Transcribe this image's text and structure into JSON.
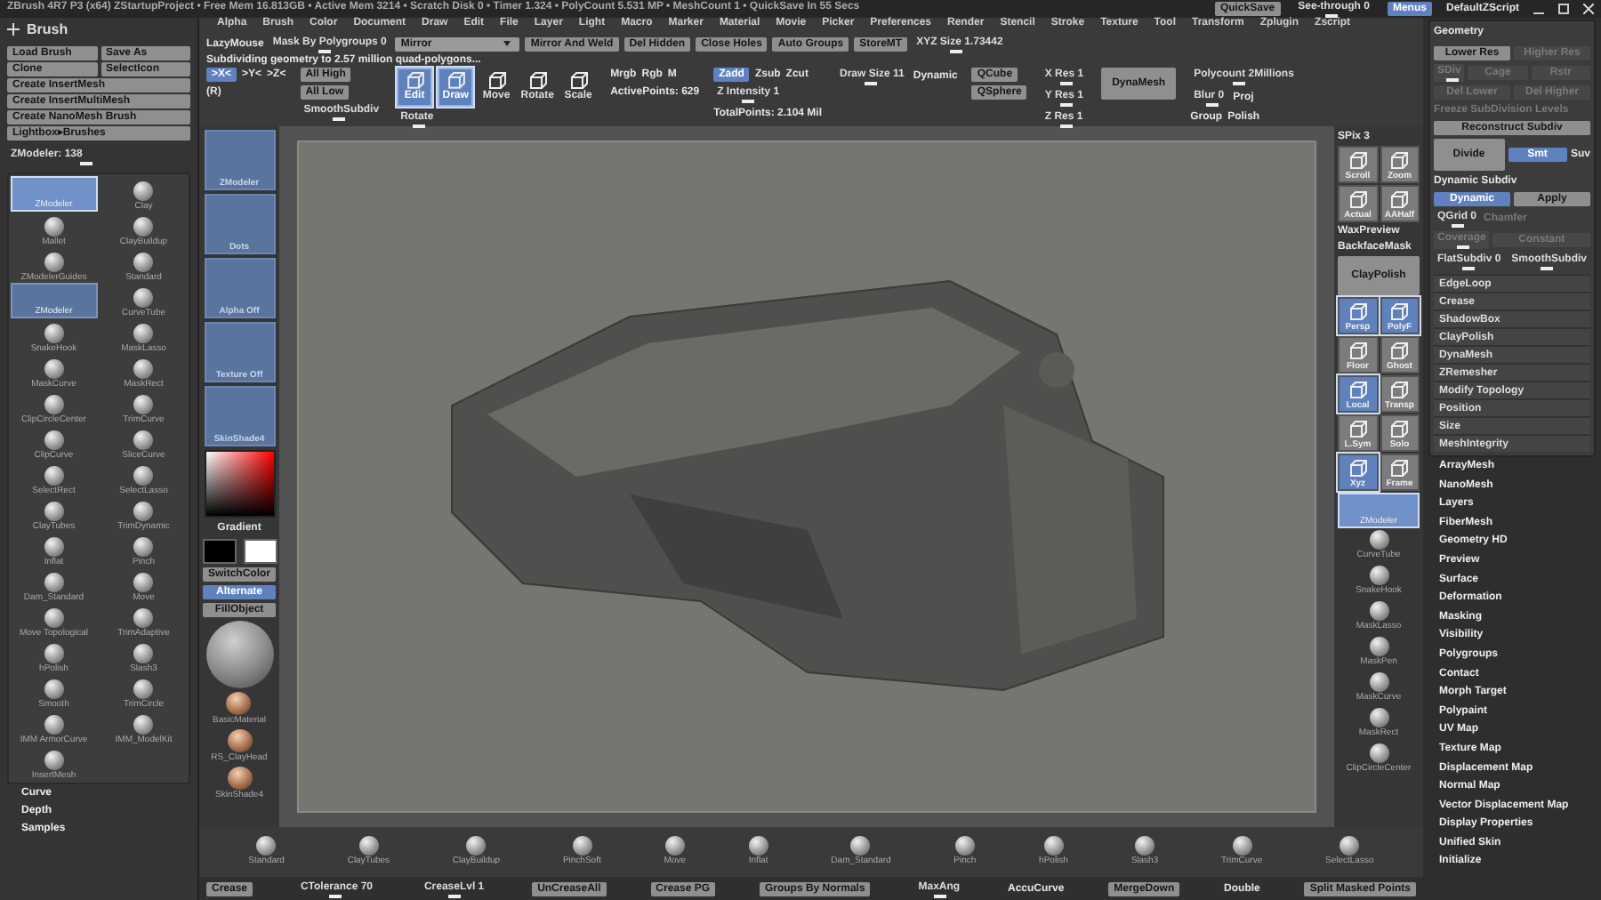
{
  "title_bar": {
    "text": "ZBrush 4R7 P3 (x64)   ZStartupProject   • Free Mem 16.813GB • Active Mem 3214 • Scratch Disk 0 • Timer 1.324 • PolyCount 5.531 MP • MeshCount 1 • QuickSave In 55 Secs",
    "controls": [
      {
        "kind": "btn",
        "label": "QuickSave",
        "selected": false
      },
      {
        "kind": "slider",
        "label": "See-through 0",
        "selected": false
      },
      {
        "kind": "btn",
        "label": "Menus",
        "selected": true
      },
      {
        "kind": "text",
        "label": "DefaultZScript",
        "selected": false
      }
    ]
  },
  "menu_bar": [
    "Alpha",
    "Brush",
    "Color",
    "Document",
    "Draw",
    "Edit",
    "File",
    "Layer",
    "Light",
    "Macro",
    "Marker",
    "Material",
    "Movie",
    "Picker",
    "Preferences",
    "Render",
    "Stencil",
    "Stroke",
    "Texture",
    "Tool",
    "Transform",
    "Zplugin",
    "Zscript"
  ],
  "brush_tray": {
    "title": "Brush",
    "buttons": [
      {
        "kind": "half",
        "label": "Load Brush"
      },
      {
        "kind": "half",
        "label": "Save As"
      },
      {
        "kind": "half",
        "label": "Clone"
      },
      {
        "kind": "half",
        "label": "SelectIcon"
      },
      {
        "kind": "full",
        "label": "Create InsertMesh"
      },
      {
        "kind": "full",
        "label": "Create InsertMultiMesh"
      },
      {
        "kind": "full",
        "label": "Create NanoMesh Brush"
      },
      {
        "kind": "full",
        "label": "Lightbox▸Brushes"
      }
    ],
    "current": "ZModeler: 138",
    "brushes": [
      {
        "kind": "tile",
        "label": "ZModeler",
        "selected": true
      },
      {
        "kind": "icon",
        "label": "Clay",
        "selected": false
      },
      {
        "kind": "icon",
        "label": "Mallet",
        "selected": false
      },
      {
        "kind": "icon",
        "label": "ClayBuildup",
        "selected": false
      },
      {
        "kind": "icon",
        "label": "ZModelerGuides",
        "selected": false
      },
      {
        "kind": "icon",
        "label": "Standard",
        "selected": false
      },
      {
        "kind": "tile",
        "label": "ZModeler",
        "selected": false
      },
      {
        "kind": "icon",
        "label": "CurveTube",
        "selected": false
      },
      {
        "kind": "icon",
        "label": "SnakeHook",
        "selected": false
      },
      {
        "kind": "icon",
        "label": "MaskLasso",
        "selected": false
      },
      {
        "kind": "icon",
        "label": "MaskCurve",
        "selected": false
      },
      {
        "kind": "icon",
        "label": "MaskRect",
        "selected": false
      },
      {
        "kind": "icon",
        "label": "ClipCircleCenter",
        "selected": false
      },
      {
        "kind": "icon",
        "label": "TrimCurve",
        "selected": false
      },
      {
        "kind": "icon",
        "label": "ClipCurve",
        "selected": false
      },
      {
        "kind": "icon",
        "label": "SliceCurve",
        "selected": false
      },
      {
        "kind": "icon",
        "label": "SelectRect",
        "selected": false
      },
      {
        "kind": "icon",
        "label": "SelectLasso",
        "selected": false
      },
      {
        "kind": "icon",
        "label": "ClayTubes",
        "selected": false
      },
      {
        "kind": "icon",
        "label": "TrimDynamic",
        "selected": false
      },
      {
        "kind": "icon",
        "label": "Inflat",
        "selected": false
      },
      {
        "kind": "icon",
        "label": "Pinch",
        "selected": false
      },
      {
        "kind": "icon",
        "label": "Dam_Standard",
        "selected": false
      },
      {
        "kind": "icon",
        "label": "Move",
        "selected": false
      },
      {
        "kind": "icon",
        "label": "Move Topological",
        "selected": false
      },
      {
        "kind": "icon",
        "label": "TrimAdaptive",
        "selected": false
      },
      {
        "kind": "icon",
        "label": "hPolish",
        "selected": false
      },
      {
        "kind": "icon",
        "label": "Slash3",
        "selected": false
      },
      {
        "kind": "icon",
        "label": "Smooth",
        "selected": false
      },
      {
        "kind": "icon",
        "label": "TrimCircle",
        "selected": false
      },
      {
        "kind": "icon",
        "label": "IMM ArmorCurve",
        "selected": false
      },
      {
        "kind": "icon",
        "label": "IMM_ModelKit",
        "selected": false
      },
      {
        "kind": "icon",
        "label": "InsertMesh",
        "selected": false
      }
    ],
    "sections": [
      "Curve",
      "Depth",
      "Samples"
    ]
  },
  "toolbar": {
    "row": [
      {
        "kind": "text",
        "label": "LazyMouse",
        "selected": false
      },
      {
        "kind": "slider",
        "label": "Mask By Polygroups 0",
        "selected": false
      },
      {
        "kind": "dropdown",
        "label": "Mirror",
        "selected": false
      },
      {
        "kind": "btn",
        "label": "Mirror And Weld",
        "selected": false
      },
      {
        "kind": "btn",
        "label": "Del Hidden",
        "selected": false
      },
      {
        "kind": "btn",
        "label": "Close Holes",
        "selected": false
      },
      {
        "kind": "btn",
        "label": "Auto Groups",
        "selected": false
      },
      {
        "kind": "btn",
        "label": "StoreMT",
        "selected": false
      },
      {
        "kind": "slider",
        "label": "XYZ Size 1.73442",
        "selected": false
      }
    ],
    "status": "Subdividing geometry to 2.57 million quad-polygons...",
    "columns": [
      {
        "rows": [
          [
            {
              "kind": "btn",
              "label": ">X<",
              "selected": true
            },
            {
              "kind": "text",
              "label": ">Y<",
              "selected": false
            },
            {
              "kind": "text",
              "label": ">Z<",
              "selected": false
            }
          ],
          [
            {
              "kind": "text",
              "label": "(R)",
              "selected": false
            }
          ]
        ]
      },
      {
        "rows": [
          [
            {
              "kind": "btn",
              "label": "All High",
              "selected": false
            }
          ],
          [
            {
              "kind": "btn",
              "label": "All Low",
              "selected": false
            }
          ],
          [
            {
              "kind": "slider",
              "label": "SmoothSubdiv",
              "selected": false
            }
          ]
        ]
      },
      {
        "rows": [
          [
            {
              "kind": "tool",
              "label": "Edit",
              "selected": true
            },
            {
              "kind": "tool",
              "label": "Draw",
              "selected": true
            },
            {
              "kind": "tool",
              "label": "Move",
              "selected": false
            },
            {
              "kind": "tool",
              "label": "Rotate",
              "selected": false
            },
            {
              "kind": "tool",
              "label": "Scale",
              "selected": false
            }
          ],
          [
            {
              "kind": "slider",
              "label": "Rotate",
              "selected": false
            }
          ]
        ]
      },
      {
        "rows": [
          [
            {
              "kind": "text",
              "label": "Mrgb",
              "selected": false
            },
            {
              "kind": "text",
              "label": "Rgb",
              "selected": false
            },
            {
              "kind": "text",
              "label": "M",
              "selected": false
            }
          ],
          [
            {
              "kind": "text",
              "label": "ActivePoints: 629",
              "selected": false
            }
          ]
        ]
      },
      {
        "rows": [
          [
            {
              "kind": "btn",
              "label": "Zadd",
              "selected": true
            },
            {
              "kind": "text",
              "label": "Zsub",
              "selected": false
            },
            {
              "kind": "text",
              "label": "Zcut",
              "selected": false
            }
          ],
          [
            {
              "kind": "slider",
              "label": "Z Intensity 1",
              "selected": false
            }
          ],
          [
            {
              "kind": "text",
              "label": "TotalPoints: 2.104 Mil",
              "selected": false
            }
          ]
        ]
      },
      {
        "rows": [
          [
            {
              "kind": "slider",
              "label": "Draw Size 11",
              "selected": false
            },
            {
              "kind": "text",
              "label": "Dynamic",
              "selected": false
            }
          ]
        ]
      },
      {
        "rows": [
          [
            {
              "kind": "btn",
              "label": "QCube",
              "selected": false
            }
          ],
          [
            {
              "kind": "btn",
              "label": "QSphere",
              "selected": false
            }
          ]
        ]
      },
      {
        "rows": [
          [
            {
              "kind": "slider",
              "label": "X Res 1",
              "selected": false
            }
          ],
          [
            {
              "kind": "slider",
              "label": "Y Res 1",
              "selected": false
            }
          ],
          [
            {
              "kind": "slider",
              "label": "Z Res 1",
              "selected": false
            }
          ]
        ]
      },
      {
        "rows": [
          [
            {
              "kind": "bigbtn",
              "label": "DynaMesh",
              "selected": false
            }
          ]
        ]
      },
      {
        "rows": [
          [
            {
              "kind": "slider",
              "label": "Polycount 2Millions",
              "selected": false
            }
          ],
          [
            {
              "kind": "slider",
              "label": "Blur 0",
              "selected": false
            },
            {
              "kind": "text",
              "label": "Proj",
              "selected": false
            }
          ],
          [
            {
              "kind": "text",
              "label": "Group",
              "selected": false
            },
            {
              "kind": "text",
              "label": "Polish",
              "selected": false
            }
          ]
        ]
      }
    ]
  },
  "left_shelf": {
    "tiles": [
      {
        "label": "ZModeler"
      },
      {
        "label": "Dots"
      },
      {
        "label": "Alpha Off"
      },
      {
        "label": "Texture Off"
      },
      {
        "label": "SkinShade4"
      }
    ],
    "gradient_label": "Gradient",
    "buttons": [
      {
        "label": "SwitchColor",
        "selected": false
      },
      {
        "label": "Alternate",
        "selected": true
      },
      {
        "label": "FillObject",
        "selected": false
      }
    ],
    "materials": [
      "BasicMaterial",
      "RS_ClayHead",
      "SkinShade4"
    ]
  },
  "right_shelf": [
    {
      "kind": "text",
      "label": "SPix 3",
      "selected": false
    },
    {
      "kind": "icon",
      "label": "Scroll",
      "selected": false
    },
    {
      "kind": "icon",
      "label": "Zoom",
      "selected": false
    },
    {
      "kind": "icon",
      "label": "Actual",
      "selected": false
    },
    {
      "kind": "icon",
      "label": "AAHalf",
      "selected": false
    },
    {
      "kind": "text",
      "label": "WaxPreview",
      "selected": false
    },
    {
      "kind": "text",
      "label": "BackfaceMask",
      "selected": false
    },
    {
      "kind": "wide",
      "label": "ClayPolish",
      "selected": false
    },
    {
      "kind": "icon",
      "label": "Persp",
      "selected": true
    },
    {
      "kind": "icon",
      "label": "PolyF",
      "selected": true
    },
    {
      "kind": "icon",
      "label": "Floor",
      "selected": false
    },
    {
      "kind": "icon",
      "label": "Ghost",
      "selected": false
    },
    {
      "kind": "icon",
      "label": "Local",
      "selected": true
    },
    {
      "kind": "icon",
      "label": "Transp",
      "selected": false
    },
    {
      "kind": "icon",
      "label": "L.Sym",
      "selected": false
    },
    {
      "kind": "icon",
      "label": "Solo",
      "selected": false
    },
    {
      "kind": "icon",
      "label": "Xyz",
      "selected": true
    },
    {
      "kind": "icon",
      "label": "Frame",
      "selected": false
    },
    {
      "kind": "tile",
      "label": "ZModeler",
      "selected": true
    },
    {
      "kind": "brush",
      "label": "CurveTube",
      "selected": false
    },
    {
      "kind": "brush",
      "label": "SnakeHook",
      "selected": false
    },
    {
      "kind": "brush",
      "label": "MaskLasso",
      "selected": false
    },
    {
      "kind": "brush",
      "label": "MaskPen",
      "selected": false
    },
    {
      "kind": "brush",
      "label": "MaskCurve",
      "selected": false
    },
    {
      "kind": "brush",
      "label": "MaskRect",
      "selected": false
    },
    {
      "kind": "brush",
      "label": "ClipCircleCenter",
      "selected": false
    }
  ],
  "geometry_panel": {
    "title": "Geometry",
    "rows": [
      {
        "controls": [
          {
            "kind": "btn",
            "label": "Lower Res",
            "selected": false,
            "disabled": false
          },
          {
            "kind": "btn",
            "label": "Higher Res",
            "selected": false,
            "disabled": true
          }
        ]
      },
      {
        "controls": [
          {
            "kind": "slider",
            "label": "SDiv",
            "selected": false,
            "disabled": true
          },
          {
            "kind": "btn",
            "label": "Cage",
            "selected": false,
            "disabled": true
          },
          {
            "kind": "btn",
            "label": "Rstr",
            "selected": false,
            "disabled": true
          }
        ]
      },
      {
        "controls": [
          {
            "kind": "btn",
            "label": "Del Lower",
            "selected": false,
            "disabled": true
          },
          {
            "kind": "btn",
            "label": "Del Higher",
            "selected": false,
            "disabled": true
          }
        ]
      },
      {
        "controls": [
          {
            "kind": "text",
            "label": "Freeze SubDivision Levels",
            "selected": false,
            "disabled": true
          }
        ]
      },
      {
        "controls": [
          {
            "kind": "btn",
            "label": "Reconstruct Subdiv",
            "selected": false,
            "disabled": false
          }
        ]
      },
      {
        "controls": [
          {
            "kind": "bigbtn",
            "label": "Divide",
            "selected": false,
            "disabled": false
          },
          {
            "kind": "btn",
            "label": "Smt",
            "selected": true,
            "disabled": false
          },
          {
            "kind": "text",
            "label": "Suv",
            "selected": false,
            "disabled": false
          }
        ]
      },
      {
        "controls": [
          {
            "kind": "text",
            "label": "Dynamic Subdiv",
            "selected": false,
            "disabled": false
          }
        ]
      },
      {
        "controls": [
          {
            "kind": "btn",
            "label": "Dynamic",
            "selected": true,
            "disabled": false
          },
          {
            "kind": "btn",
            "label": "Apply",
            "selected": false,
            "disabled": false
          }
        ]
      },
      {
        "controls": [
          {
            "kind": "slider",
            "label": "QGrid 0",
            "selected": false,
            "disabled": false
          },
          {
            "kind": "text",
            "label": "Chamfer",
            "selected": false,
            "disabled": true
          }
        ]
      },
      {
        "controls": [
          {
            "kind": "slider",
            "label": "Coverage",
            "selected": false,
            "disabled": true
          },
          {
            "kind": "btn",
            "label": "Constant",
            "selected": false,
            "disabled": true
          }
        ]
      },
      {
        "controls": [
          {
            "kind": "slider",
            "label": "FlatSubdiv 0",
            "selected": false,
            "disabled": false
          },
          {
            "kind": "slider",
            "label": "SmoothSubdiv",
            "selected": false,
            "disabled": false
          }
        ]
      }
    ],
    "sub_items": [
      "EdgeLoop",
      "Crease",
      "ShadowBox",
      "ClayPolish",
      "DynaMesh",
      "ZRemesher",
      "Modify Topology",
      "Position",
      "Size",
      "MeshIntegrity"
    ]
  },
  "tool_palettes": [
    "ArrayMesh",
    "NanoMesh",
    "Layers",
    "FiberMesh",
    "Geometry HD",
    "Preview",
    "Surface",
    "Deformation",
    "Masking",
    "Visibility",
    "Polygroups",
    "Contact",
    "Morph Target",
    "Polypaint",
    "UV Map",
    "Texture Map",
    "Displacement Map",
    "Normal Map",
    "Vector Displacement Map",
    "Display Properties",
    "Unified Skin",
    "Initialize"
  ],
  "bottom_shelf": [
    "Standard",
    "ClayTubes",
    "ClayBuildup",
    "PinchSoft",
    "Move",
    "Inflat",
    "Dam_Standard",
    "Pinch",
    "hPolish",
    "Slash3",
    "TrimCurve",
    "SelectLasso"
  ],
  "bottom_bar": [
    {
      "kind": "btn",
      "label": "Crease",
      "selected": false
    },
    {
      "kind": "slider",
      "label": "CTolerance 70",
      "selected": false
    },
    {
      "kind": "slider",
      "label": "CreaseLvl 1",
      "selected": false
    },
    {
      "kind": "btn",
      "label": "UnCreaseAll",
      "selected": false
    },
    {
      "kind": "btn",
      "label": "Crease PG",
      "selected": false
    },
    {
      "kind": "btn",
      "label": "Groups By Normals",
      "selected": false
    },
    {
      "kind": "slider",
      "label": "MaxAng",
      "selected": false
    },
    {
      "kind": "text",
      "label": "AccuCurve",
      "selected": false
    },
    {
      "kind": "btn",
      "label": "MergeDown",
      "selected": false
    },
    {
      "kind": "text",
      "label": "Double",
      "selected": false
    },
    {
      "kind": "btn",
      "label": "Split Masked Points",
      "selected": false
    }
  ]
}
